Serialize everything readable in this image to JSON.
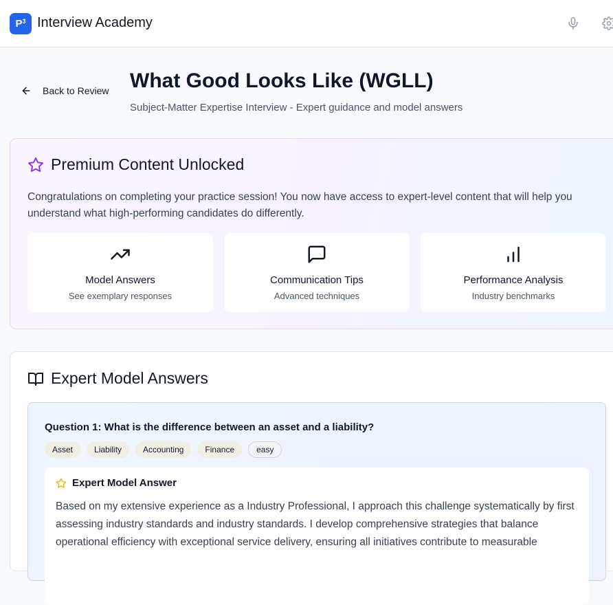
{
  "header": {
    "logo_text": "P",
    "logo_sup": "3",
    "app_title": "Interview Academy",
    "icons": [
      "mic-icon",
      "gear-icon"
    ]
  },
  "page": {
    "back_label": "Back to Review",
    "title": "What Good Looks Like (WGLL)",
    "subtitle": "Subject-Matter Expertise Interview - Expert guidance and model answers"
  },
  "premium": {
    "heading": "Premium Content Unlocked",
    "description": "Congratulations on completing your practice session! You now have access to expert-level content that will help you understand what high-performing candidates do differently.",
    "features": [
      {
        "title": "Model Answers",
        "subtitle": "See exemplary responses",
        "icon": "trending-up-icon"
      },
      {
        "title": "Communication Tips",
        "subtitle": "Advanced techniques",
        "icon": "message-square-icon"
      },
      {
        "title": "Performance Analysis",
        "subtitle": "Industry benchmarks",
        "icon": "bar-chart-icon"
      }
    ],
    "accent_color": "#9333ea"
  },
  "expert": {
    "heading": "Expert Model Answers",
    "question": {
      "title": "Question 1: What is the difference between an asset and a liability?",
      "tags": [
        "Asset",
        "Liability",
        "Accounting",
        "Finance"
      ],
      "difficulty": "easy",
      "answer_heading": "Expert Model Answer",
      "answer_text": "Based on my extensive experience as a Industry Professional, I approach this challenge systematically by first assessing industry standards and industry standards. I develop comprehensive strategies that balance operational efficiency with exceptional service delivery, ensuring all initiatives contribute to measurable"
    }
  },
  "colors": {
    "brand": "#2563eb",
    "star_gold": "#eab308"
  }
}
